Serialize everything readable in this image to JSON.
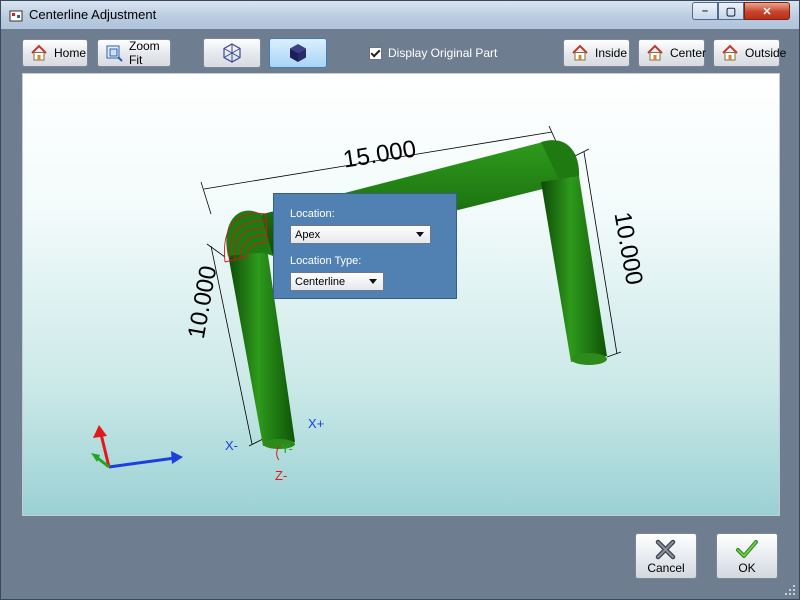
{
  "window": {
    "title": "Centerline Adjustment"
  },
  "titlebar_controls": {
    "minimize": "–",
    "maximize": "▢",
    "close": "✕"
  },
  "toolbar": {
    "home_label": "Home",
    "zoom_fit_label": "Zoom Fit",
    "display_original_label": "Display Original Part",
    "display_original_checked": true,
    "inside_label": "Inside",
    "center_label": "Center",
    "outside_label": "Outside"
  },
  "viewport": {
    "dimensions": {
      "top": "15.000",
      "left": "10.000",
      "right": "10.000"
    },
    "axis_labels": {
      "x_minus": "X-",
      "x_plus": "X+",
      "y_minus": "Y-",
      "z_minus": "Z-"
    },
    "colors": {
      "tube": "#1f7a12",
      "dimension": "#000000",
      "bend_highlight": "#d11a1a",
      "axis_x": "#1a40e0",
      "axis_y": "#1fa81f",
      "axis_z": "#e01a1a"
    }
  },
  "popup": {
    "location_label": "Location:",
    "location_value": "Apex",
    "location_type_label": "Location Type:",
    "location_type_value": "Centerline"
  },
  "footer": {
    "cancel_label": "Cancel",
    "ok_label": "OK"
  }
}
